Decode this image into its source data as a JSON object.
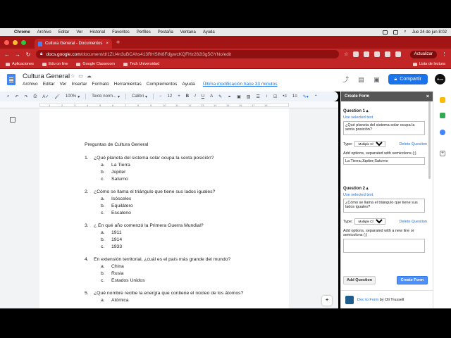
{
  "macos": {
    "app_name": "Chrome",
    "menus": [
      "Archivo",
      "Editar",
      "Ver",
      "Historial",
      "Favoritos",
      "Perfiles",
      "Pestaña",
      "Ventana",
      "Ayuda"
    ],
    "datetime": "Jue 24 de jun  8:02"
  },
  "browser": {
    "tab_title": "Cultura General - Documentos",
    "url_domain": "docs.google.com",
    "url_path": "/document/d/1ZU4n3uBCAhs413RHSlN8FdjywcKQFHz262l3g5GYNo/edit",
    "update_label": "Actualizar",
    "bookmarks": [
      "Aplicaciones",
      "Edu on line",
      "Google Classroom",
      "Tech Universidad"
    ],
    "reading_list": "Lista de lectura"
  },
  "docs": {
    "title": "Cultura General",
    "menu": [
      "Archivo",
      "Editar",
      "Ver",
      "Insertar",
      "Formato",
      "Herramientas",
      "Complementos",
      "Ayuda"
    ],
    "last_edit": "Última modificación hace 33 minutos",
    "share_label": "Compartir",
    "avatar_text": "Mom",
    "toolbar": {
      "zoom": "100%",
      "style": "Texto norm...",
      "font": "Calibri",
      "size": "12",
      "bold": "B",
      "italic": "I",
      "underline": "U",
      "color": "A"
    },
    "ruler_ticks": [
      "1",
      "2",
      "3",
      "4",
      "5",
      "6",
      "7",
      "8",
      "9",
      "10",
      "11",
      "12",
      "13",
      "14",
      "15",
      "16",
      "17",
      "18"
    ]
  },
  "document": {
    "heading": "Preguntas de Cultura General",
    "questions": [
      {
        "num": "1.",
        "text": "¿Qué planeta del sistema solar ocupa la sexta posición?",
        "options": [
          {
            "l": "a.",
            "t": "La Tierra"
          },
          {
            "l": "b.",
            "t": "Júpiter"
          },
          {
            "l": "c.",
            "t": "Saturno"
          }
        ]
      },
      {
        "num": "2.",
        "text": "¿Cómo se llama el triángulo que tiene sus lados iguales?",
        "options": [
          {
            "l": "a.",
            "t": "Isósceles"
          },
          {
            "l": "b.",
            "t": "Equilátero"
          },
          {
            "l": "c.",
            "t": "Escaleno"
          }
        ]
      },
      {
        "num": "3.",
        "text": "¿ En qué año comenzó la Primera Guerra Mundial?",
        "options": [
          {
            "l": "a.",
            "t": "1911"
          },
          {
            "l": "b.",
            "t": "1914"
          },
          {
            "l": "c.",
            "t": "1933"
          }
        ]
      },
      {
        "num": "4.",
        "text": "En extensión territorial, ¿cuál es el país más grande del mundo?",
        "options": [
          {
            "l": "a.",
            "t": "China"
          },
          {
            "l": "b.",
            "t": "Rusia"
          },
          {
            "l": "c.",
            "t": "Estados Unidos"
          }
        ]
      },
      {
        "num": "5.",
        "text": "¿Qué nombre recibe la energía que contiene el núcleo de los átomos?",
        "options": [
          {
            "l": "a.",
            "t": "Atómica"
          }
        ]
      }
    ]
  },
  "panel": {
    "title": "Create Form",
    "close": "×",
    "q1": {
      "title": "Question 1 ▴",
      "use_selected": "Use selected text",
      "text": "¿Qué planeta del sistema solar ocupa la sexta posición?",
      "type_label": "Type:",
      "type_value": "Multiple Cho...",
      "delete": "Delete Question",
      "options_label": "Add options, separated with semicolons (;)",
      "options_value": "La Tierra;Júpiter;Saturno"
    },
    "q2": {
      "title": "Question 2 ▴",
      "use_selected": "Use selected text",
      "text": "¿Cómo se llama el triángulo que tiene sus lados iguales?",
      "type_label": "Type:",
      "type_value": "Multiple Cho...",
      "delete": "Delete Question",
      "options_label": "Add options, separated with a new line or semicolons (;)",
      "options_value": ""
    },
    "add_question": "Add Question",
    "create_form": "Create Form",
    "footer_link": "Doc to Form",
    "footer_by": " by Oli Trussell"
  },
  "colors": {
    "browser_red": "#c12525",
    "docs_blue": "#1a73e8",
    "panel_header": "#555555"
  }
}
